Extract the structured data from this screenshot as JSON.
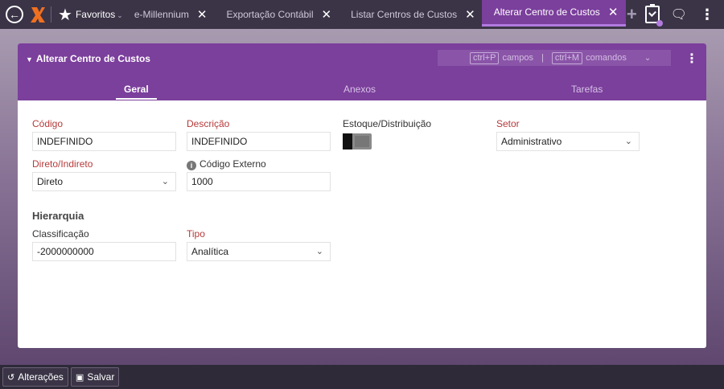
{
  "topbar": {
    "favorites_label": "Favoritos",
    "tabs": [
      {
        "label": "e-Millennium"
      },
      {
        "label": "Exportação Contábil"
      },
      {
        "label": "Listar Centros de Custos"
      },
      {
        "label": "Alterar Centro de Custos"
      }
    ],
    "accent_color": "#7b3f9c"
  },
  "card": {
    "title": "Alterar Centro de Custos",
    "shortcuts": {
      "key1": "ctrl+P",
      "label1": "campos",
      "separator": "|",
      "key2": "ctrl+M",
      "label2": "comandos"
    },
    "subtabs": [
      {
        "label": "Geral",
        "active": true
      },
      {
        "label": "Anexos",
        "active": false
      },
      {
        "label": "Tarefas",
        "active": false
      }
    ]
  },
  "form": {
    "codigo": {
      "label": "Código",
      "value": "INDEFINIDO"
    },
    "descricao": {
      "label": "Descrição",
      "value": "INDEFINIDO"
    },
    "estoque": {
      "label": "Estoque/Distribuição",
      "checked": false
    },
    "setor": {
      "label": "Setor",
      "value": "Administrativo"
    },
    "direto": {
      "label": "Direto/Indireto",
      "value": "Direto"
    },
    "codigo_externo": {
      "label": "Código Externo",
      "value": "1000"
    },
    "hierarquia": {
      "title": "Hierarquia"
    },
    "classificacao": {
      "label": "Classificação",
      "value": "-2000000000"
    },
    "tipo": {
      "label": "Tipo",
      "value": "Analítica"
    }
  },
  "bottombar": {
    "alteracoes_label": "Alterações",
    "salvar_label": "Salvar"
  }
}
